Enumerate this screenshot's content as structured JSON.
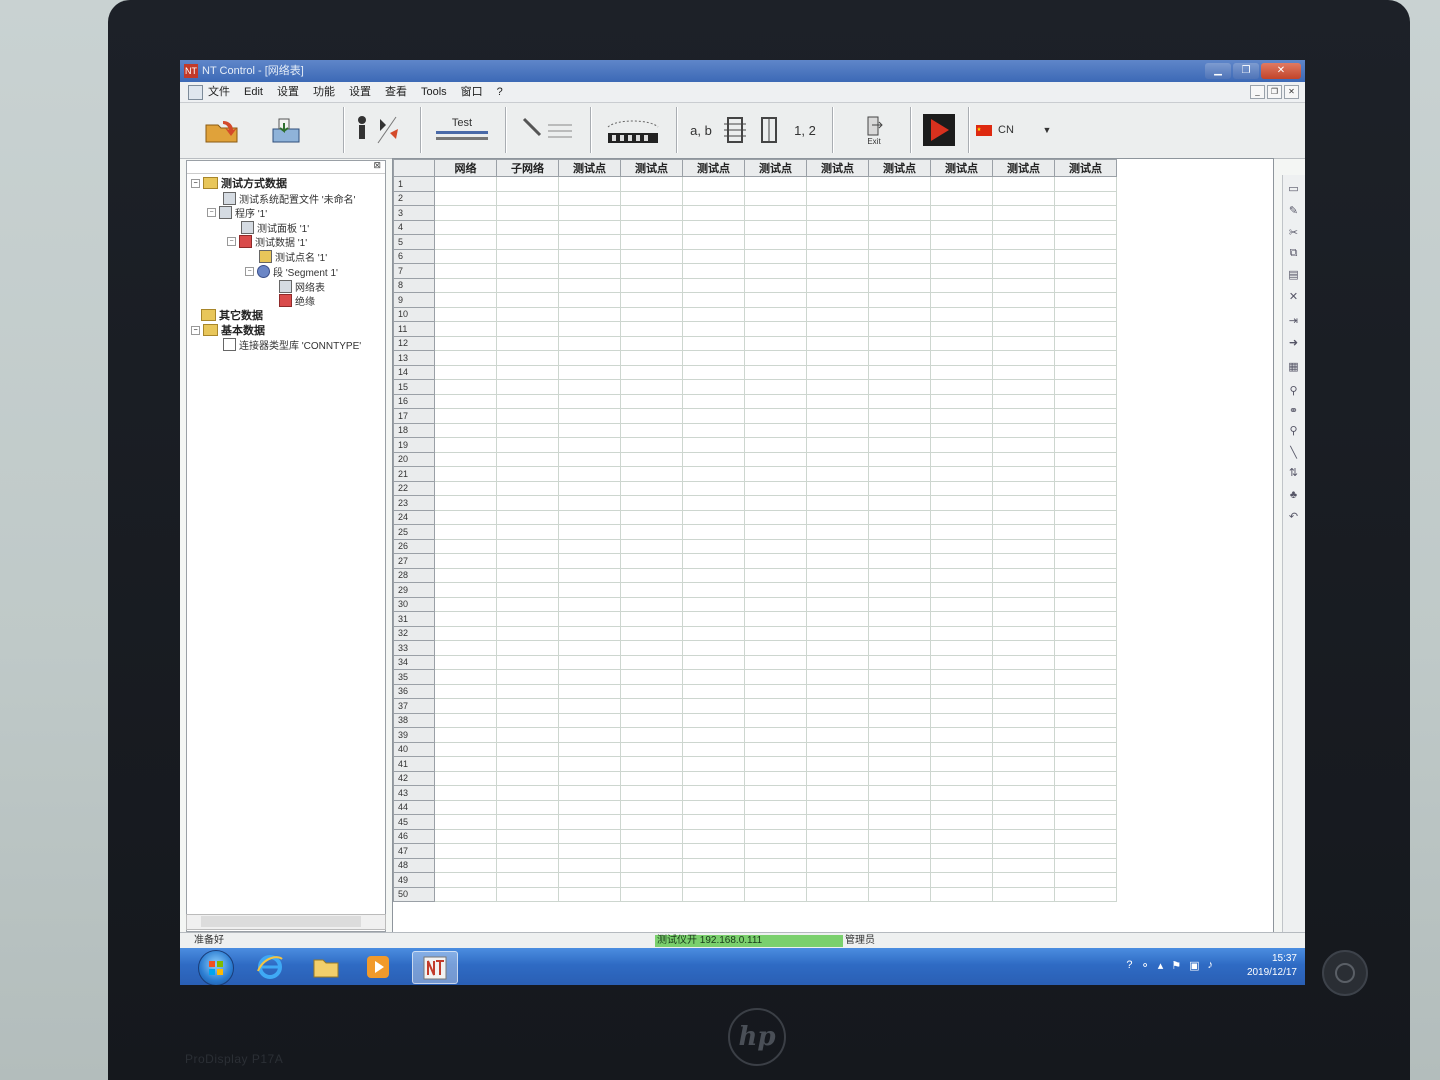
{
  "window": {
    "app_icon": "NT",
    "title": "NT Control - [网络表]"
  },
  "menu": [
    "文件",
    "Edit",
    "设置",
    "功能",
    "设置",
    "查看",
    "Tools",
    "窗口",
    "?"
  ],
  "toolbar": {
    "test_label": "Test",
    "ab_label": "a, b",
    "num_label": "1, 2",
    "exit_label": "Exit",
    "lang_label": "CN"
  },
  "tree": {
    "root": "测试方式数据",
    "config_file": "测试系统配置文件 '未命名'",
    "program": "程序 '1'",
    "panel": "测试面板 '1'",
    "test_data": "测试数据 '1'",
    "point_name": "测试点名 '1'",
    "segment": "段 'Segment 1'",
    "netlist": "网络表",
    "insulation": "绝缘",
    "other": "其它数据",
    "basic": "基本数据",
    "conn_lib": "连接器类型库 'CONNTYPE'"
  },
  "grid": {
    "headers": [
      "网络",
      "子网络",
      "测试点",
      "测试点",
      "测试点",
      "测试点",
      "测试点",
      "测试点",
      "测试点",
      "测试点",
      "测试点"
    ],
    "row_count": 50
  },
  "status": {
    "left": "准备好",
    "connection": "测试仪开 192.168.0.111",
    "user": "管理员"
  },
  "taskbar": {
    "time": "15:37",
    "date": "2019/12/17"
  },
  "monitor": {
    "brand": "hp",
    "model": "ProDisplay P17A"
  }
}
